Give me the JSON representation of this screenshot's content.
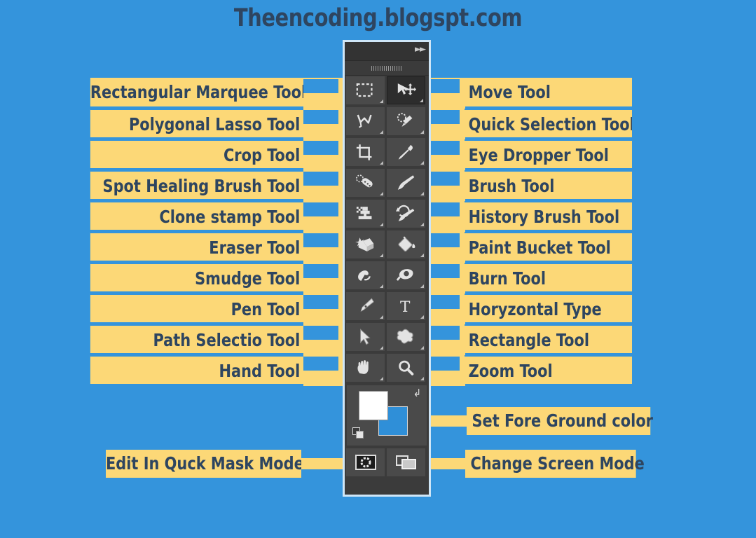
{
  "title": "Theencoding.blogspt.com",
  "colors": {
    "background_blue": "#3494dc",
    "label_yellow": "#fcd877",
    "text_navy": "#2e4560",
    "panel_dark": "#3b3b3b",
    "cell_gray": "#4a4a4a",
    "foreground_swatch": "#ffffff",
    "background_swatch": "#2f8fd8"
  },
  "panel": {
    "collapse_icon": "double-chevron-right-icon",
    "grip_icon": "panel-grip-icon"
  },
  "tool_rows": [
    {
      "left_label": "Rectangular Marquee Tool",
      "left_icon": "rectangular-marquee-icon",
      "right_label": "Move Tool",
      "right_icon": "move-tool-icon"
    },
    {
      "left_label": "Polygonal Lasso Tool",
      "left_icon": "polygonal-lasso-icon",
      "right_label": "Quick Selection Tool",
      "right_icon": "quick-selection-icon"
    },
    {
      "left_label": "Crop Tool",
      "left_icon": "crop-icon",
      "right_label": "Eye Dropper Tool",
      "right_icon": "eyedropper-icon"
    },
    {
      "left_label": "Spot Healing Brush Tool",
      "left_icon": "spot-healing-brush-icon",
      "right_label": "Brush Tool",
      "right_icon": "brush-icon"
    },
    {
      "left_label": "Clone stamp Tool",
      "left_icon": "clone-stamp-icon",
      "right_label": "History Brush Tool",
      "right_icon": "history-brush-icon"
    },
    {
      "left_label": "Eraser Tool",
      "left_icon": "eraser-icon",
      "right_label": "Paint Bucket Tool",
      "right_icon": "paint-bucket-icon"
    },
    {
      "left_label": "Smudge Tool",
      "left_icon": "smudge-icon",
      "right_label": "Burn Tool",
      "right_icon": "burn-icon"
    },
    {
      "left_label": "Pen Tool",
      "left_icon": "pen-icon",
      "right_label": "Horyzontal Type",
      "right_icon": "horizontal-type-icon"
    },
    {
      "left_label": "Path Selectio Tool",
      "left_icon": "path-selection-icon",
      "right_label": "Rectangle Tool",
      "right_icon": "custom-shape-icon"
    },
    {
      "left_label": "Hand Tool",
      "left_icon": "hand-icon",
      "right_label": "Zoom Tool",
      "right_icon": "zoom-icon"
    }
  ],
  "color_section": {
    "label": "Set Fore Ground color",
    "foreground_icon": "foreground-color-swatch",
    "background_icon": "background-color-swatch",
    "swap_icon": "swap-colors-icon",
    "default_icon": "default-colors-icon"
  },
  "bottom_section": {
    "left_label": "Edit In Quck Mask Mode",
    "left_icon": "quick-mask-icon",
    "right_label": "Change Screen Mode",
    "right_icon": "screen-mode-icon"
  }
}
